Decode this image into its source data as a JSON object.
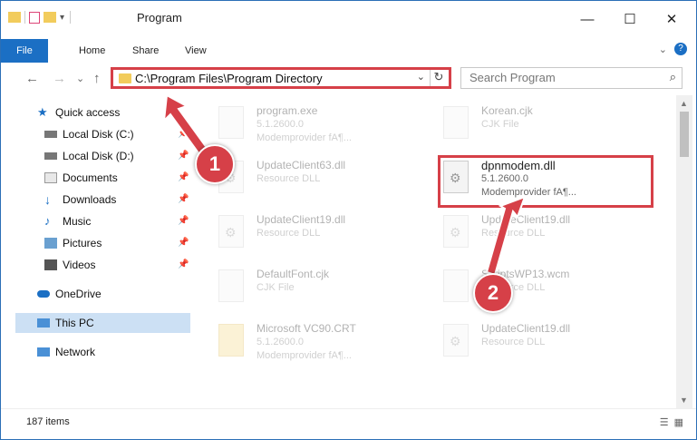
{
  "window": {
    "title": "Program",
    "minimize": "—",
    "maximize": "☐",
    "close": "✕"
  },
  "ribbon": {
    "file": "File",
    "tabs": [
      "Home",
      "Share",
      "View"
    ],
    "expand": "⌄",
    "help": "?"
  },
  "address": {
    "back": "←",
    "forward": "→",
    "recent": "⌄",
    "up": "↑",
    "path": "C:\\Program Files\\Program Directory",
    "dropdown": "⌄",
    "refresh": "↻"
  },
  "search": {
    "placeholder": "Search Program",
    "icon": "⌕"
  },
  "nav": {
    "items": [
      {
        "label": "Quick access",
        "pinned": false,
        "icon": "star-icon"
      },
      {
        "label": "Local Disk (C:)",
        "pinned": true,
        "icon": "drive-icon"
      },
      {
        "label": "Local Disk (D:)",
        "pinned": true,
        "icon": "drive-icon"
      },
      {
        "label": "Documents",
        "pinned": true,
        "icon": "documents-icon"
      },
      {
        "label": "Downloads",
        "pinned": true,
        "icon": "downloads-icon"
      },
      {
        "label": "Music",
        "pinned": true,
        "icon": "music-icon"
      },
      {
        "label": "Pictures",
        "pinned": true,
        "icon": "pictures-icon"
      },
      {
        "label": "Videos",
        "pinned": true,
        "icon": "videos-icon"
      },
      {
        "label": "OneDrive",
        "pinned": false,
        "icon": "cloud-icon"
      },
      {
        "label": "This PC",
        "pinned": false,
        "icon": "computer-icon"
      },
      {
        "label": "Network",
        "pinned": false,
        "icon": "network-icon"
      }
    ]
  },
  "files": {
    "left": [
      {
        "name": "program.exe",
        "sub1": "5.1.2600.0",
        "sub2": "Modemprovider fA¶..."
      },
      {
        "name": "UpdateClient63.dll",
        "sub1": "Resource DLL",
        "sub2": ""
      },
      {
        "name": "UpdateClient19.dll",
        "sub1": "Resource DLL",
        "sub2": ""
      },
      {
        "name": "DefaultFont.cjk",
        "sub1": "CJK File",
        "sub2": ""
      },
      {
        "name": "Microsoft VC90.CRT",
        "sub1": "5.1.2600.0",
        "sub2": "Modemprovider fA¶..."
      }
    ],
    "right": [
      {
        "name": "Korean.cjk",
        "sub1": "CJK File",
        "sub2": ""
      },
      {
        "name": "dpnmodem.dll",
        "sub1": "5.1.2600.0",
        "sub2": "Modemprovider fA¶..."
      },
      {
        "name": "UpdateClient19.dll",
        "sub1": "Resource DLL",
        "sub2": ""
      },
      {
        "name": "ScriptsWP13.wcm",
        "sub1": "Resource DLL",
        "sub2": ""
      },
      {
        "name": "UpdateClient19.dll",
        "sub1": "Resource DLL",
        "sub2": ""
      }
    ]
  },
  "status": {
    "count": "187 items"
  },
  "callouts": [
    "1",
    "2"
  ],
  "colors": {
    "accent": "#1b6fc4",
    "highlight": "#d64048",
    "selected": "#cce0f4"
  }
}
